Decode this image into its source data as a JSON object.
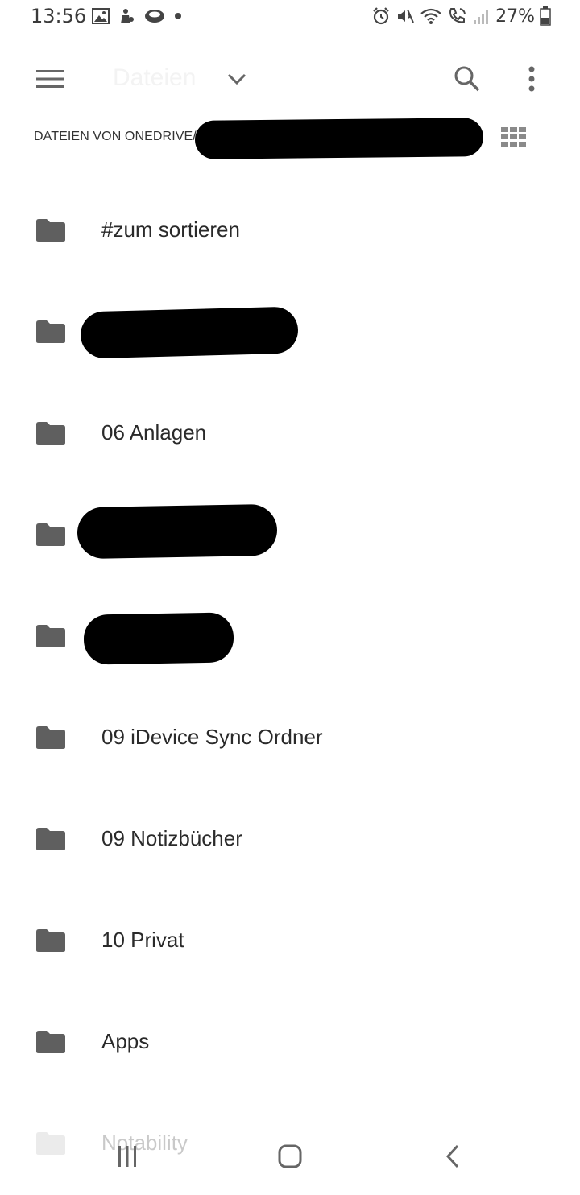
{
  "status_bar": {
    "time": "13:56",
    "battery_percent": "27%",
    "left_icons": [
      "gallery-icon",
      "android-notification-icon",
      "cloud-icon",
      "dot-icon"
    ],
    "right_icons": [
      "alarm-icon",
      "mute-icon",
      "wifi-icon",
      "wifi-calling-icon",
      "signal-icon",
      "battery-icon"
    ]
  },
  "app_bar": {
    "title": "Dateien",
    "icons": [
      "menu-icon",
      "chevron-down-icon",
      "search-icon",
      "more-vert-icon"
    ]
  },
  "breadcrumb": {
    "path": "DATEIEN VON ONEDRIVE/"
  },
  "toolbar": {
    "view_toggle_icon": "grid-view-icon"
  },
  "files": [
    {
      "name": "#zum sortieren",
      "redacted": false
    },
    {
      "name": "",
      "redacted": true
    },
    {
      "name": "06 Anlagen",
      "redacted": false
    },
    {
      "name": "",
      "redacted": true
    },
    {
      "name": "",
      "redacted": true
    },
    {
      "name": "09 iDevice Sync Ordner",
      "redacted": false
    },
    {
      "name": "09 Notizbücher",
      "redacted": false
    },
    {
      "name": "10 Privat",
      "redacted": false
    },
    {
      "name": "Apps",
      "redacted": false
    },
    {
      "name": "Notability",
      "redacted": false
    }
  ],
  "nav_bar": {
    "icons": [
      "recents-icon",
      "home-icon",
      "back-icon"
    ]
  },
  "colors": {
    "icon": "#5f5f5f",
    "text": "#2a2a2a",
    "background": "#ffffff"
  }
}
